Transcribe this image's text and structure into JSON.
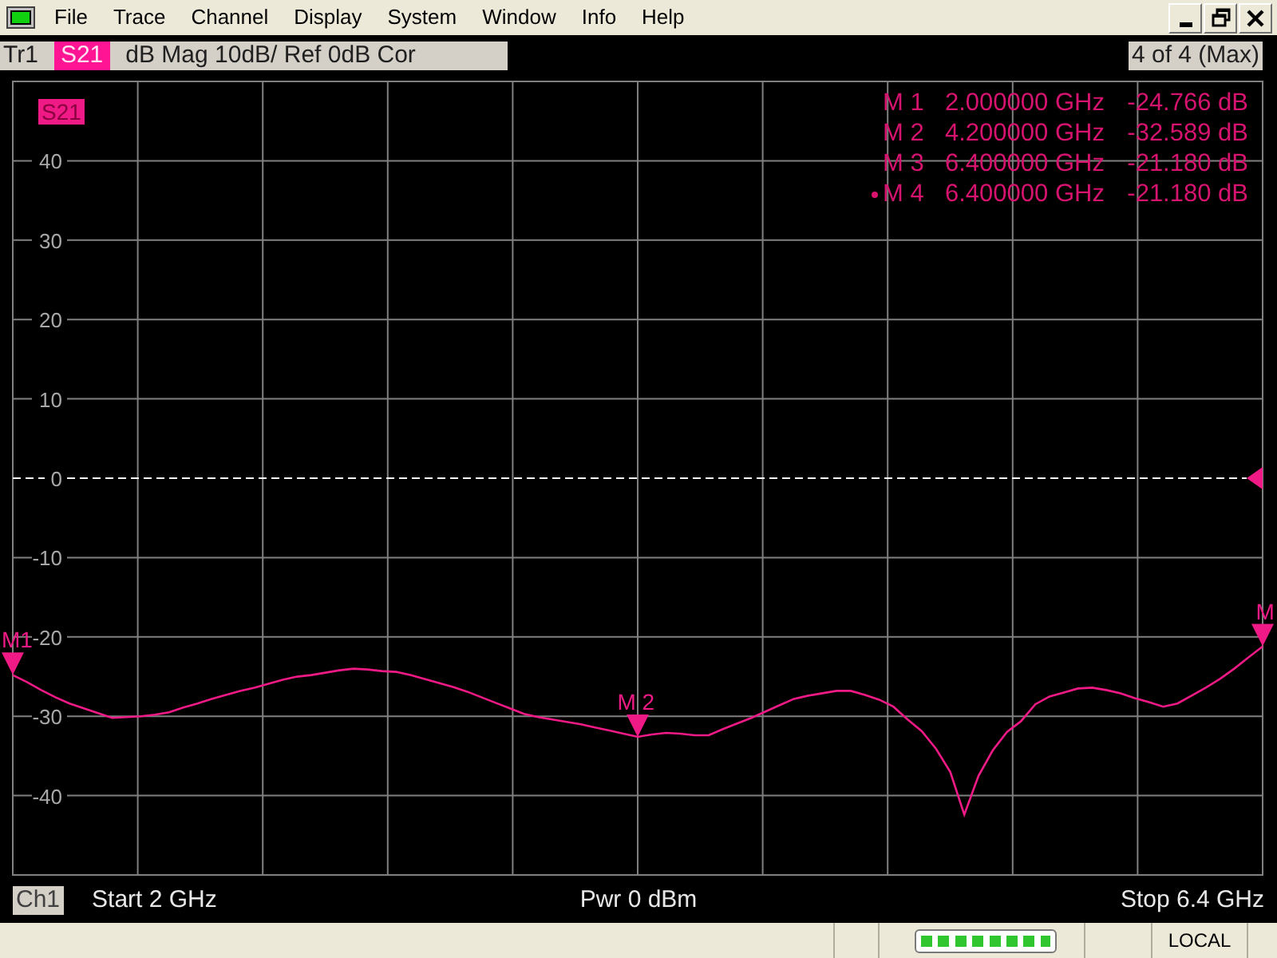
{
  "menu_bar": {
    "items": [
      "File",
      "Trace",
      "Channel",
      "Display",
      "System",
      "Window",
      "Info",
      "Help"
    ]
  },
  "trace_title": {
    "trace": "Tr1",
    "parameter": "S21",
    "format": "dB Mag 10dB/ Ref 0dB Cor"
  },
  "trace_count": "4 of 4 (Max)",
  "markers": [
    {
      "name": "M 1",
      "stimulus": "2.000000 GHz",
      "response": "-24.766 dB",
      "selected": false
    },
    {
      "name": "M 2",
      "stimulus": "4.200000 GHz",
      "response": "-32.589 dB",
      "selected": false
    },
    {
      "name": "M 3",
      "stimulus": "6.400000 GHz",
      "response": "-21.180 dB",
      "selected": false
    },
    {
      "name": "M 4",
      "stimulus": "6.400000 GHz",
      "response": "-21.180 dB",
      "selected": true
    }
  ],
  "chart_data": {
    "type": "line",
    "grid": true,
    "ylim": [
      -50,
      50
    ],
    "yticks": [
      40,
      30,
      20,
      10,
      0,
      -10,
      -20,
      -30,
      -40
    ],
    "categories": [
      null,
      null,
      null,
      null,
      null,
      null,
      null,
      null,
      null,
      null,
      null,
      null,
      null,
      null,
      null,
      null,
      null,
      null,
      null,
      null,
      null,
      null,
      null,
      null,
      null,
      null,
      null,
      null,
      null,
      null,
      null,
      null,
      null,
      null,
      null,
      null,
      null,
      null,
      null,
      null,
      null,
      null,
      null,
      null,
      null,
      null,
      null,
      null,
      null,
      null,
      null,
      null,
      null,
      null,
      null,
      null,
      null,
      null,
      null,
      null,
      null,
      null,
      null,
      null,
      null,
      null,
      null,
      null,
      null,
      null,
      null,
      null,
      null,
      null,
      null,
      null,
      null,
      null,
      null,
      null,
      null,
      null,
      null,
      null,
      null,
      null,
      null,
      null,
      null
    ],
    "series": [
      {
        "name": "S21",
        "color": "#f01a86",
        "values": [
          -24.8,
          -25.7,
          -26.7,
          -27.6,
          -28.4,
          -29.0,
          -29.6,
          -30.2,
          -30.1,
          -30.0,
          -29.8,
          -29.5,
          -28.9,
          -28.4,
          -27.8,
          -27.3,
          -26.8,
          -26.4,
          -25.9,
          -25.4,
          -25.0,
          -24.8,
          -24.5,
          -24.2,
          -24.0,
          -24.1,
          -24.3,
          -24.4,
          -24.8,
          -25.3,
          -25.8,
          -26.3,
          -26.9,
          -27.6,
          -28.3,
          -29.0,
          -29.7,
          -30.1,
          -30.4,
          -30.7,
          -31.0,
          -31.4,
          -31.8,
          -32.2,
          -32.6,
          -32.3,
          -32.1,
          -32.2,
          -32.4,
          -32.4,
          -31.6,
          -30.9,
          -30.2,
          -29.4,
          -28.6,
          -27.8,
          -27.4,
          -27.1,
          -26.8,
          -26.8,
          -27.3,
          -27.9,
          -28.8,
          -30.4,
          -31.9,
          -34.1,
          -37.0,
          -42.4,
          -37.5,
          -34.3,
          -32.0,
          -30.6,
          -28.5,
          -27.5,
          -27.0,
          -26.5,
          -26.4,
          -26.7,
          -27.1,
          -27.7,
          -28.2,
          -28.8,
          -28.4,
          -27.4,
          -26.4,
          -25.3,
          -24.0,
          -22.6,
          -21.2
        ]
      }
    ],
    "ref_lines": [
      {
        "axis": "y",
        "value": 0
      }
    ],
    "annotations": [
      {
        "y": -24.766,
        "text": "M1"
      },
      {
        "y": -32.589,
        "text": "M 2"
      },
      {
        "y": -21.18,
        "text": "M"
      }
    ]
  },
  "channel_bar": {
    "channel": "Ch1",
    "start": "Start 2 GHz",
    "power": "Pwr 0 dBm",
    "stop": "Stop 6.4 GHz"
  },
  "status_bar": {
    "indicator": {
      "level": 1
    },
    "mode": "LOCAL"
  }
}
